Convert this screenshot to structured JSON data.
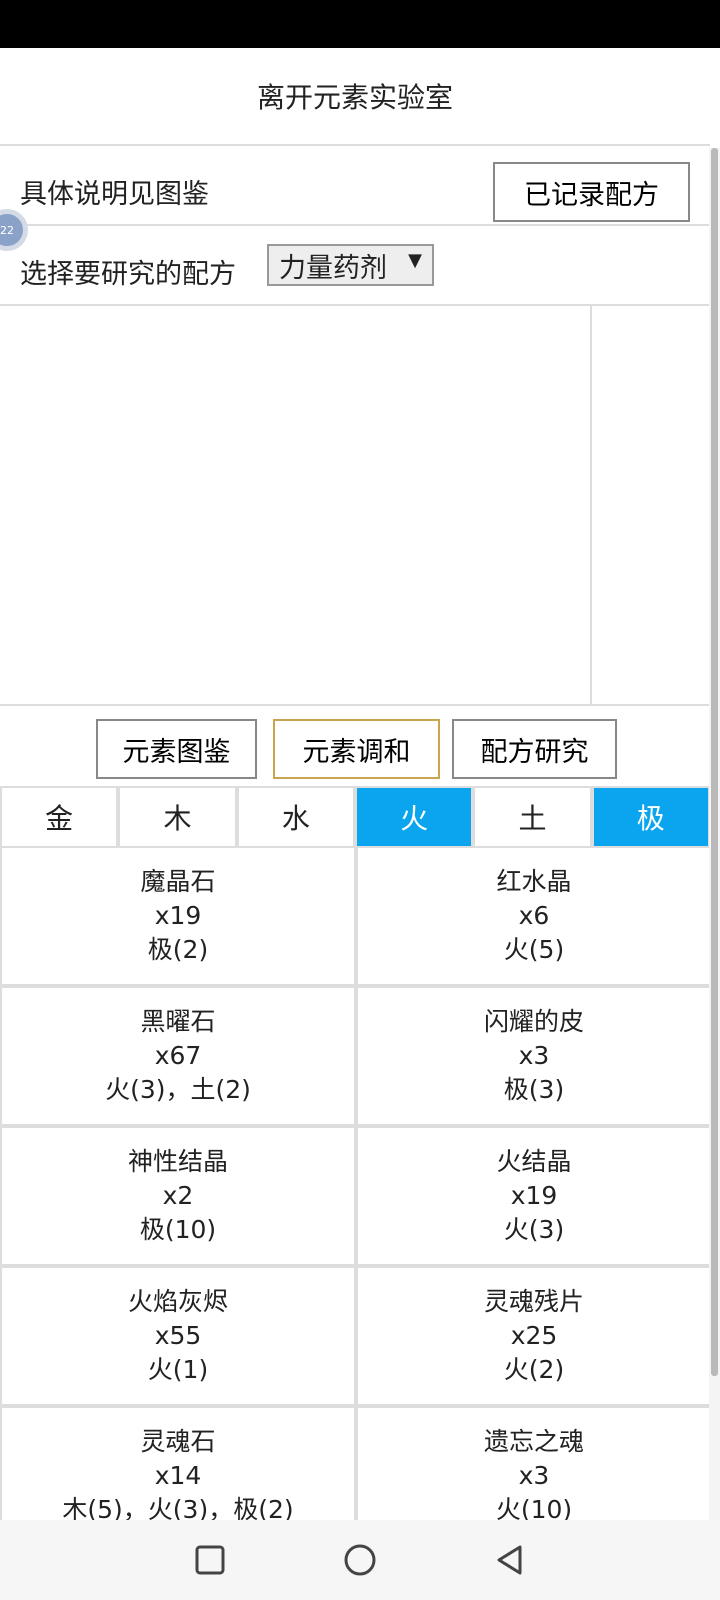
{
  "header": {
    "title": "离开元素实验室"
  },
  "info": {
    "text": "具体说明见图鉴",
    "recorded_button": "已记录配方"
  },
  "float_ball_label": "22",
  "recipe": {
    "label": "选择要研究的配方",
    "selected": "力量药剂"
  },
  "modes": [
    {
      "label": "元素图鉴",
      "active": false
    },
    {
      "label": "元素调和",
      "active": true
    },
    {
      "label": "配方研究",
      "active": false
    }
  ],
  "element_tabs": [
    {
      "label": "金",
      "selected": false
    },
    {
      "label": "木",
      "selected": false
    },
    {
      "label": "水",
      "selected": false
    },
    {
      "label": "火",
      "selected": true
    },
    {
      "label": "土",
      "selected": false
    },
    {
      "label": "极",
      "selected": true
    }
  ],
  "materials": [
    {
      "name": "魔晶石",
      "count": "x19",
      "elements": "极(2)"
    },
    {
      "name": "红水晶",
      "count": "x6",
      "elements": "火(5)"
    },
    {
      "name": "黑曜石",
      "count": "x67",
      "elements": "火(3)，土(2)"
    },
    {
      "name": "闪耀的皮",
      "count": "x3",
      "elements": "极(3)"
    },
    {
      "name": "神性结晶",
      "count": "x2",
      "elements": "极(10)"
    },
    {
      "name": "火结晶",
      "count": "x19",
      "elements": "火(3)"
    },
    {
      "name": "火焰灰烬",
      "count": "x55",
      "elements": "火(1)"
    },
    {
      "name": "灵魂残片",
      "count": "x25",
      "elements": "火(2)"
    },
    {
      "name": "灵魂石",
      "count": "x14",
      "elements": "木(5)，火(3)，极(2)"
    },
    {
      "name": "遗忘之魂",
      "count": "x3",
      "elements": "火(10)"
    }
  ],
  "colors": {
    "accent_blue": "#0aa5ee",
    "active_border": "#c9a64e"
  },
  "icons": {
    "nav": [
      "square-icon",
      "circle-icon",
      "back-triangle-icon"
    ]
  }
}
